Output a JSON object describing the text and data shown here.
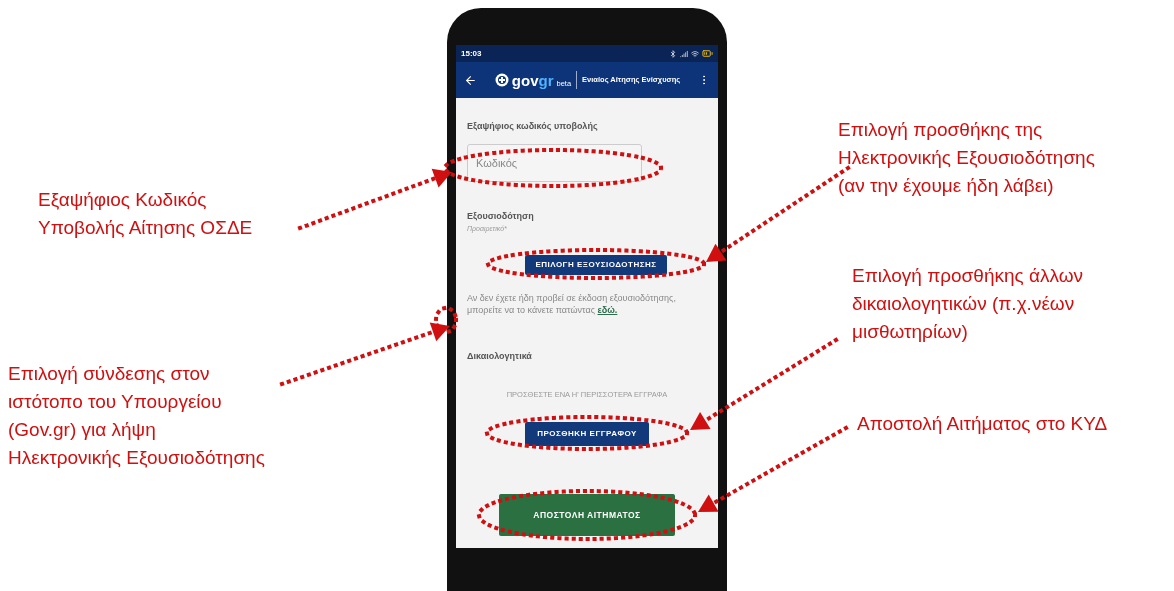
{
  "phone": {
    "status_bar": {
      "time": "15:03"
    },
    "app_bar": {
      "logo": {
        "part_1": "gov",
        "part_2": "gr",
        "tag": "beta"
      },
      "title": "Ενιαίος Αίτησης Ενίσχυσης"
    },
    "form": {
      "code_label": "Εξαψήφιος κωδικός υποβολής",
      "code_placeholder": "Κωδικός",
      "authorization_label": "Εξουσιοδότηση",
      "authorization_hint": "Προαιρετικό*",
      "authorization_button": "ΕΠΙΛΟΓΗ ΕΞΟΥΣΙΟΔΟΤΗΣΗΣ",
      "help_text": "Αν δεν έχετε ήδη προβεί σε έκδοση εξουσιοδότησης, μπορείτε να το κάνετε πατώντας",
      "help_link": "εδώ.",
      "documents_label": "Δικαιολογητικά",
      "documents_hint": "ΠΡΟΣΘΕΣΤΕ ΕΝΑ Η' ΠΕΡΙΣΣΟΤΕΡΑ ΕΓΓΡΑΦΑ",
      "add_document_button": "ΠΡΟΣΘΗΚΗ ΕΓΓΡΑΦΟΥ",
      "submit_button": "ΑΠΟΣΤΟΛΗ ΑΙΤΗΜΑΤΟΣ"
    }
  },
  "annotations": [
    {
      "lines": [
        "Εξαψήφιος Κωδικός",
        "Υποβολής Αίτησης ΟΣΔΕ"
      ]
    },
    {
      "lines": [
        "Επιλογή σύνδεσης στον",
        "ιστότοπο του Υπουργείου",
        "(Gov.gr) για λήψη",
        "Ηλεκτρονικής Εξουσιοδότησης"
      ]
    },
    {
      "lines": [
        "Επιλογή προσθήκης της",
        "Ηλεκτρονικής Εξουσιοδότησης",
        "(αν την έχουμε ήδη λάβει)"
      ]
    },
    {
      "lines": [
        "Επιλογή προσθήκης άλλων",
        "δικαιολογητικών (π.χ.νέων",
        "μισθωτηρίων)"
      ]
    },
    {
      "lines": [
        "Αποστολή Αιτήματος στο ΚΥΔ"
      ]
    }
  ]
}
